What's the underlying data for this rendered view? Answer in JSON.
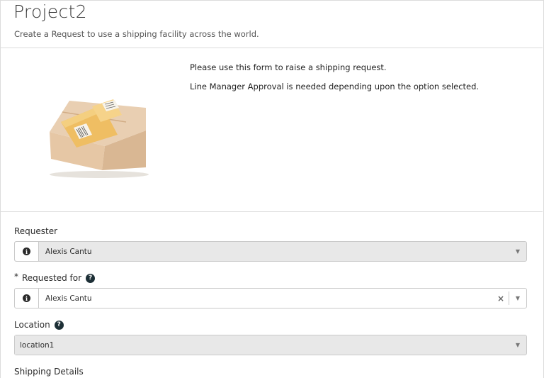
{
  "header": {
    "title": "Project2",
    "subtitle": "Create a Request to use a shipping facility across the world."
  },
  "intro": {
    "image_icon": "cardboard-box-with-parcel-image",
    "line1": "Please use this form to raise a shipping request.",
    "line2": "Line Manager Approval is needed depending upon the option selected."
  },
  "form": {
    "requester": {
      "label": "Requester",
      "value": "Alexis Cantu",
      "icon": "info-icon"
    },
    "requested_for": {
      "required_mark": "*",
      "label": "Requested for",
      "help_icon": "question-circle-icon",
      "value": "Alexis Cantu",
      "icon": "info-icon",
      "clear_glyph": "×",
      "caret_glyph": "▼"
    },
    "location": {
      "label": "Location",
      "help_icon": "question-circle-icon",
      "value": "location1",
      "caret_glyph": "▼"
    },
    "shipping_details": {
      "label": "Shipping Details"
    }
  },
  "colors": {
    "readonly_bg": "#e8e8e8",
    "border": "#c9c9c9",
    "icon_dark": "#1d2f36"
  }
}
